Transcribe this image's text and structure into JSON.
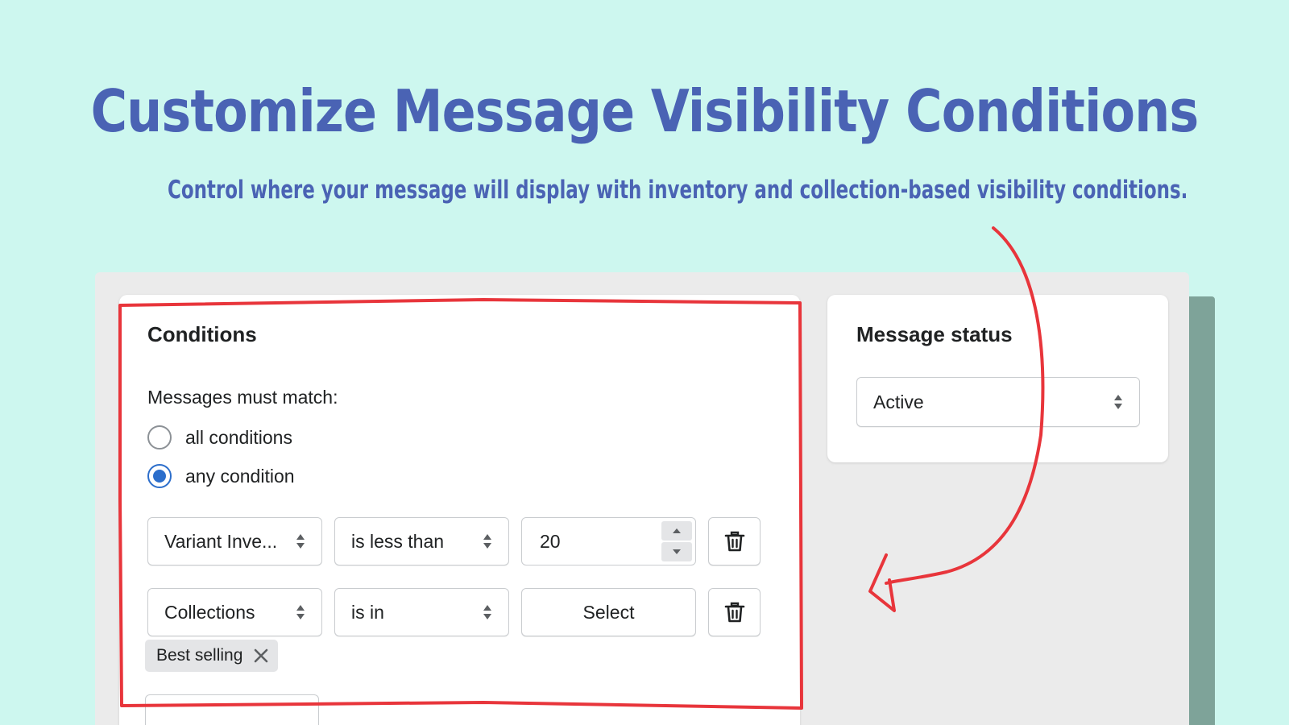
{
  "hero": {
    "title": "Customize Message Visibility Conditions",
    "subtitle": "Control where your message will display with inventory and collection-based visibility conditions."
  },
  "conditions": {
    "title": "Conditions",
    "match_label": "Messages must match:",
    "options": [
      {
        "label": "all conditions",
        "checked": false
      },
      {
        "label": "any condition",
        "checked": true
      }
    ],
    "rules": [
      {
        "field": "Variant Inve...",
        "operator": "is less than",
        "value": "20"
      },
      {
        "field": "Collections",
        "operator": "is in",
        "value_button": "Select"
      }
    ],
    "tags": [
      {
        "label": "Best selling"
      }
    ]
  },
  "status": {
    "title": "Message status",
    "selected": "Active"
  },
  "colors": {
    "background": "#cdf7ef",
    "heading": "#4a63b4",
    "radio_accent": "#2c6ecb",
    "annotation": "#e8353b"
  },
  "icons": [
    "select-arrows-icon",
    "stepper-up-icon",
    "stepper-down-icon",
    "trash-icon",
    "close-icon",
    "hand-drawn-arrow"
  ]
}
